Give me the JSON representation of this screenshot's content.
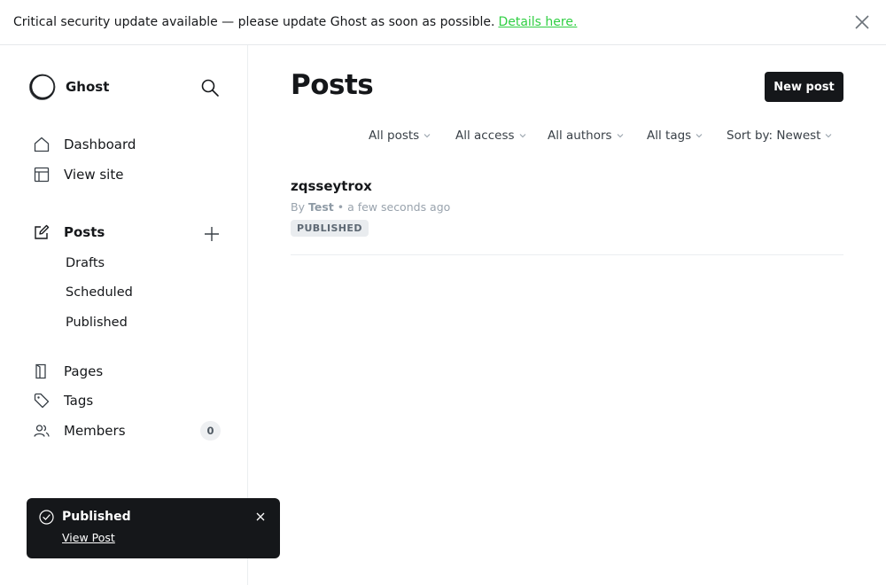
{
  "banner": {
    "message": "Critical security update available — please update Ghost as soon as possible.",
    "link": "Details here.",
    "link_color": "#30cf43"
  },
  "sidebar": {
    "brand": "Ghost",
    "items": [
      {
        "label": "Dashboard",
        "icon": "home-icon"
      },
      {
        "label": "View site",
        "icon": "layout-icon"
      },
      {
        "label": "Posts",
        "icon": "edit-icon"
      },
      {
        "label": "Pages",
        "icon": "page-icon"
      },
      {
        "label": "Tags",
        "icon": "tag-icon"
      },
      {
        "label": "Members",
        "icon": "members-icon"
      }
    ],
    "sub_items": [
      "Drafts",
      "Scheduled",
      "Published"
    ],
    "members_count": "0"
  },
  "main": {
    "title": "Posts",
    "new_post_label": "New post",
    "filters": [
      "All posts",
      "All access",
      "All authors",
      "All tags",
      "Sort by: Newest"
    ],
    "posts": [
      {
        "title": "zqsseytrox",
        "by": "By",
        "author": "Test",
        "time": "• a few seconds ago",
        "status": "PUBLISHED"
      }
    ]
  },
  "toast": {
    "title": "Published",
    "link": "View Post"
  },
  "colors": {
    "primary": "#15171a",
    "accent_green": "#30cf43",
    "muted": "#99a3ad"
  }
}
